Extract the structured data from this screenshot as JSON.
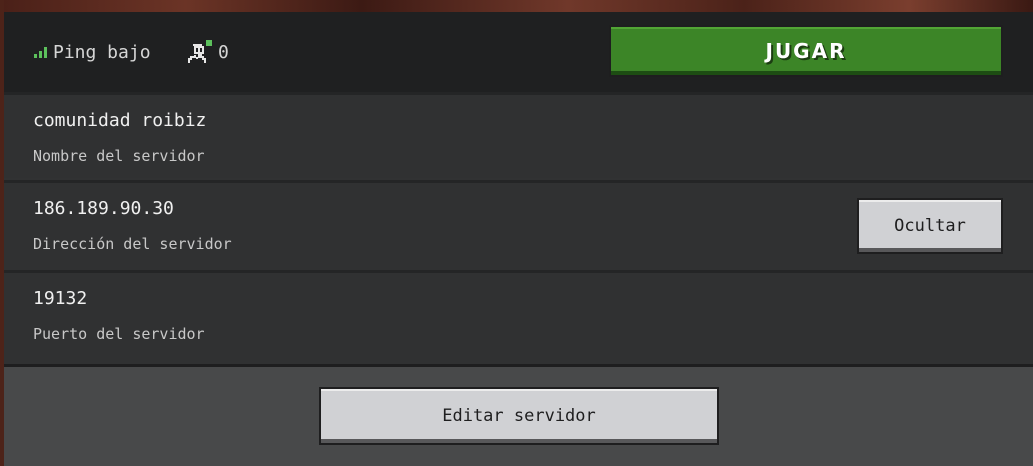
{
  "header": {
    "ping_label": "Ping bajo",
    "ping_icon": "signal-bars-icon",
    "players_icon": "players-icon",
    "players_count": "0",
    "play_button": "JUGAR"
  },
  "server": {
    "name_value": "comunidad roibiz",
    "name_label": "Nombre del servidor",
    "address_value": "186.189.90.30",
    "address_label": "Dirección del servidor",
    "hide_button": "Ocultar",
    "port_value": "19132",
    "port_label": "Puerto del servidor"
  },
  "footer": {
    "edit_button": "Editar servidor"
  },
  "colors": {
    "play_green": "#3c8527",
    "ping_green": "#5cc15c",
    "panel_dark": "#1f2021",
    "row_bg": "#303132",
    "button_grey": "#d0d1d4"
  }
}
